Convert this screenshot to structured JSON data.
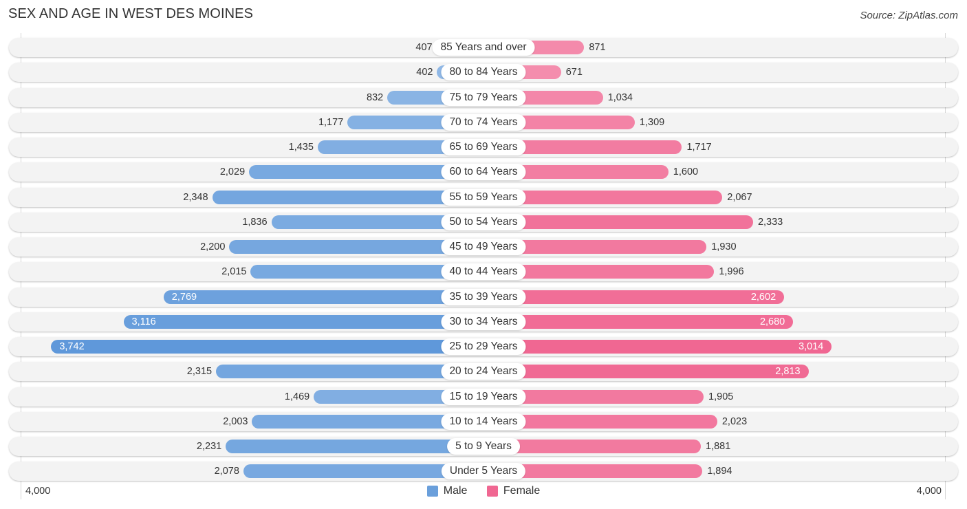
{
  "header": {
    "title": "SEX AND AGE IN WEST DES MOINES",
    "source": "Source: ZipAtlas.com"
  },
  "chart_data": {
    "type": "bar",
    "orientation": "horizontal-diverging",
    "title": "SEX AND AGE IN WEST DES MOINES",
    "source": "Source: ZipAtlas.com",
    "categories": [
      "85 Years and over",
      "80 to 84 Years",
      "75 to 79 Years",
      "70 to 74 Years",
      "65 to 69 Years",
      "60 to 64 Years",
      "55 to 59 Years",
      "50 to 54 Years",
      "45 to 49 Years",
      "40 to 44 Years",
      "35 to 39 Years",
      "30 to 34 Years",
      "25 to 29 Years",
      "20 to 24 Years",
      "15 to 19 Years",
      "10 to 14 Years",
      "5 to 9 Years",
      "Under 5 Years"
    ],
    "series": [
      {
        "name": "Male",
        "side": "left",
        "color": "#6a9fdb",
        "values": [
          407,
          402,
          832,
          1177,
          1435,
          2029,
          2348,
          1836,
          2200,
          2015,
          2769,
          3116,
          3742,
          2315,
          1469,
          2003,
          2231,
          2078
        ],
        "labels": [
          "407",
          "402",
          "832",
          "1,177",
          "1,435",
          "2,029",
          "2,348",
          "1,836",
          "2,200",
          "2,015",
          "2,769",
          "3,116",
          "3,742",
          "2,315",
          "1,469",
          "2,003",
          "2,231",
          "2,078"
        ]
      },
      {
        "name": "Female",
        "side": "right",
        "color": "#f06792",
        "values": [
          871,
          671,
          1034,
          1309,
          1717,
          1600,
          2067,
          2333,
          1930,
          1996,
          2602,
          2680,
          3014,
          2813,
          1905,
          2023,
          1881,
          1894
        ],
        "labels": [
          "871",
          "671",
          "1,034",
          "1,309",
          "1,717",
          "1,600",
          "2,067",
          "2,333",
          "1,930",
          "1,996",
          "2,602",
          "2,680",
          "3,014",
          "2,813",
          "1,905",
          "2,023",
          "1,881",
          "1,894"
        ]
      }
    ],
    "xlim": [
      -4000,
      4000
    ],
    "x_ticks": [
      {
        "value": -4000,
        "label": "4,000"
      },
      {
        "value": 4000,
        "label": "4,000"
      }
    ],
    "xlabel": "",
    "ylabel": "",
    "legend": {
      "position": "bottom-center",
      "entries": [
        "Male",
        "Female"
      ]
    },
    "grid": false
  }
}
